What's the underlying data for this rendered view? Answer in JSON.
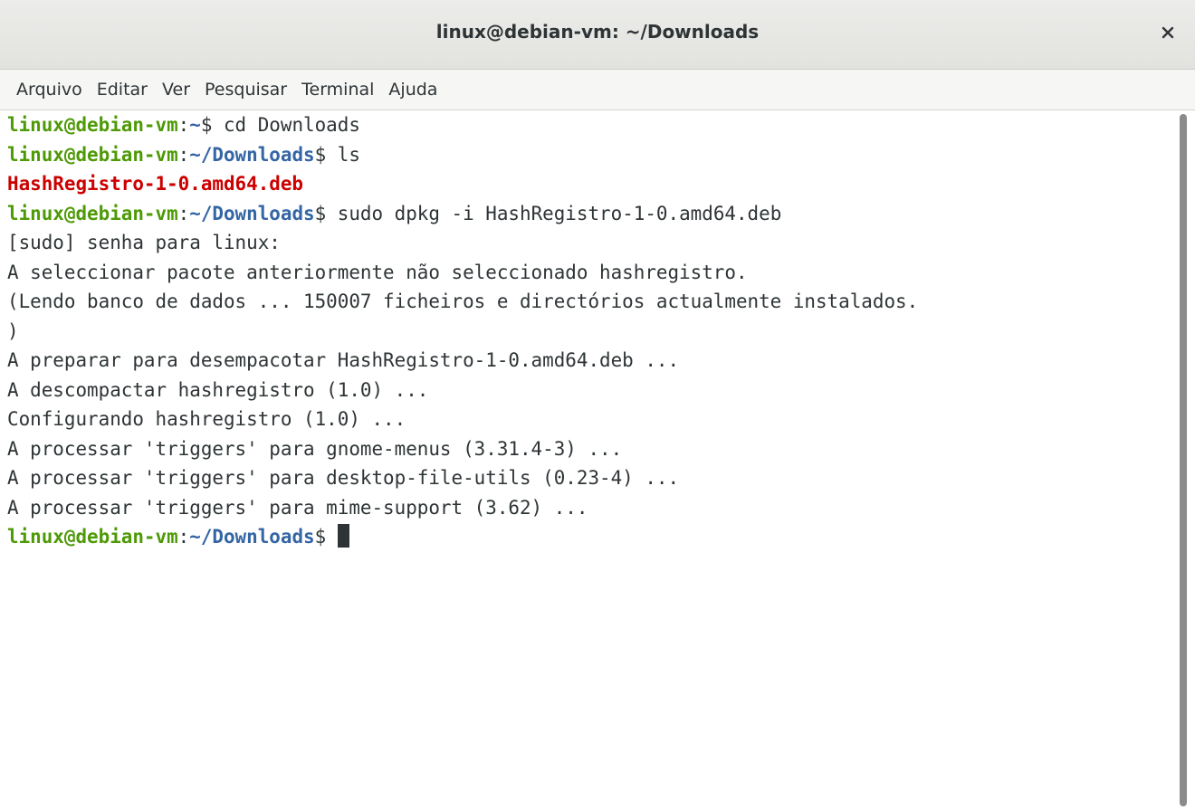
{
  "window": {
    "title": "linux@debian-vm: ~/Downloads"
  },
  "menubar": {
    "items": [
      {
        "label": "Arquivo"
      },
      {
        "label": "Editar"
      },
      {
        "label": "Ver"
      },
      {
        "label": "Pesquisar"
      },
      {
        "label": "Terminal"
      },
      {
        "label": "Ajuda"
      }
    ]
  },
  "terminal": {
    "prompt_user": "linux@debian-vm",
    "prompt_colon": ":",
    "prompt_home": "~",
    "prompt_downloads": "~/Downloads",
    "prompt_dollar": "$",
    "lines": [
      {
        "type": "prompt",
        "path": "~",
        "command": " cd Downloads"
      },
      {
        "type": "prompt",
        "path": "~/Downloads",
        "command": " ls"
      },
      {
        "type": "file",
        "text": "HashRegistro-1-0.amd64.deb"
      },
      {
        "type": "prompt",
        "path": "~/Downloads",
        "command": " sudo dpkg -i HashRegistro-1-0.amd64.deb"
      },
      {
        "type": "output",
        "text": "[sudo] senha para linux:"
      },
      {
        "type": "output",
        "text": "A seleccionar pacote anteriormente não seleccionado hashregistro."
      },
      {
        "type": "output",
        "text": "(Lendo banco de dados ... 150007 ficheiros e directórios actualmente instalados."
      },
      {
        "type": "output",
        "text": ")"
      },
      {
        "type": "output",
        "text": "A preparar para desempacotar HashRegistro-1-0.amd64.deb ..."
      },
      {
        "type": "output",
        "text": "A descompactar hashregistro (1.0) ..."
      },
      {
        "type": "output",
        "text": "Configurando hashregistro (1.0) ..."
      },
      {
        "type": "output",
        "text": "A processar 'triggers' para gnome-menus (3.31.4-3) ..."
      },
      {
        "type": "output",
        "text": "A processar 'triggers' para desktop-file-utils (0.23-4) ..."
      },
      {
        "type": "output",
        "text": "A processar 'triggers' para mime-support (3.62) ..."
      },
      {
        "type": "prompt",
        "path": "~/Downloads",
        "command": " ",
        "cursor": true
      }
    ]
  },
  "colors": {
    "prompt_user": "#4e9a06",
    "prompt_path": "#3465a4",
    "deb_file": "#cc0000",
    "text": "#2e3436"
  },
  "icons": {
    "close": "close-icon"
  }
}
